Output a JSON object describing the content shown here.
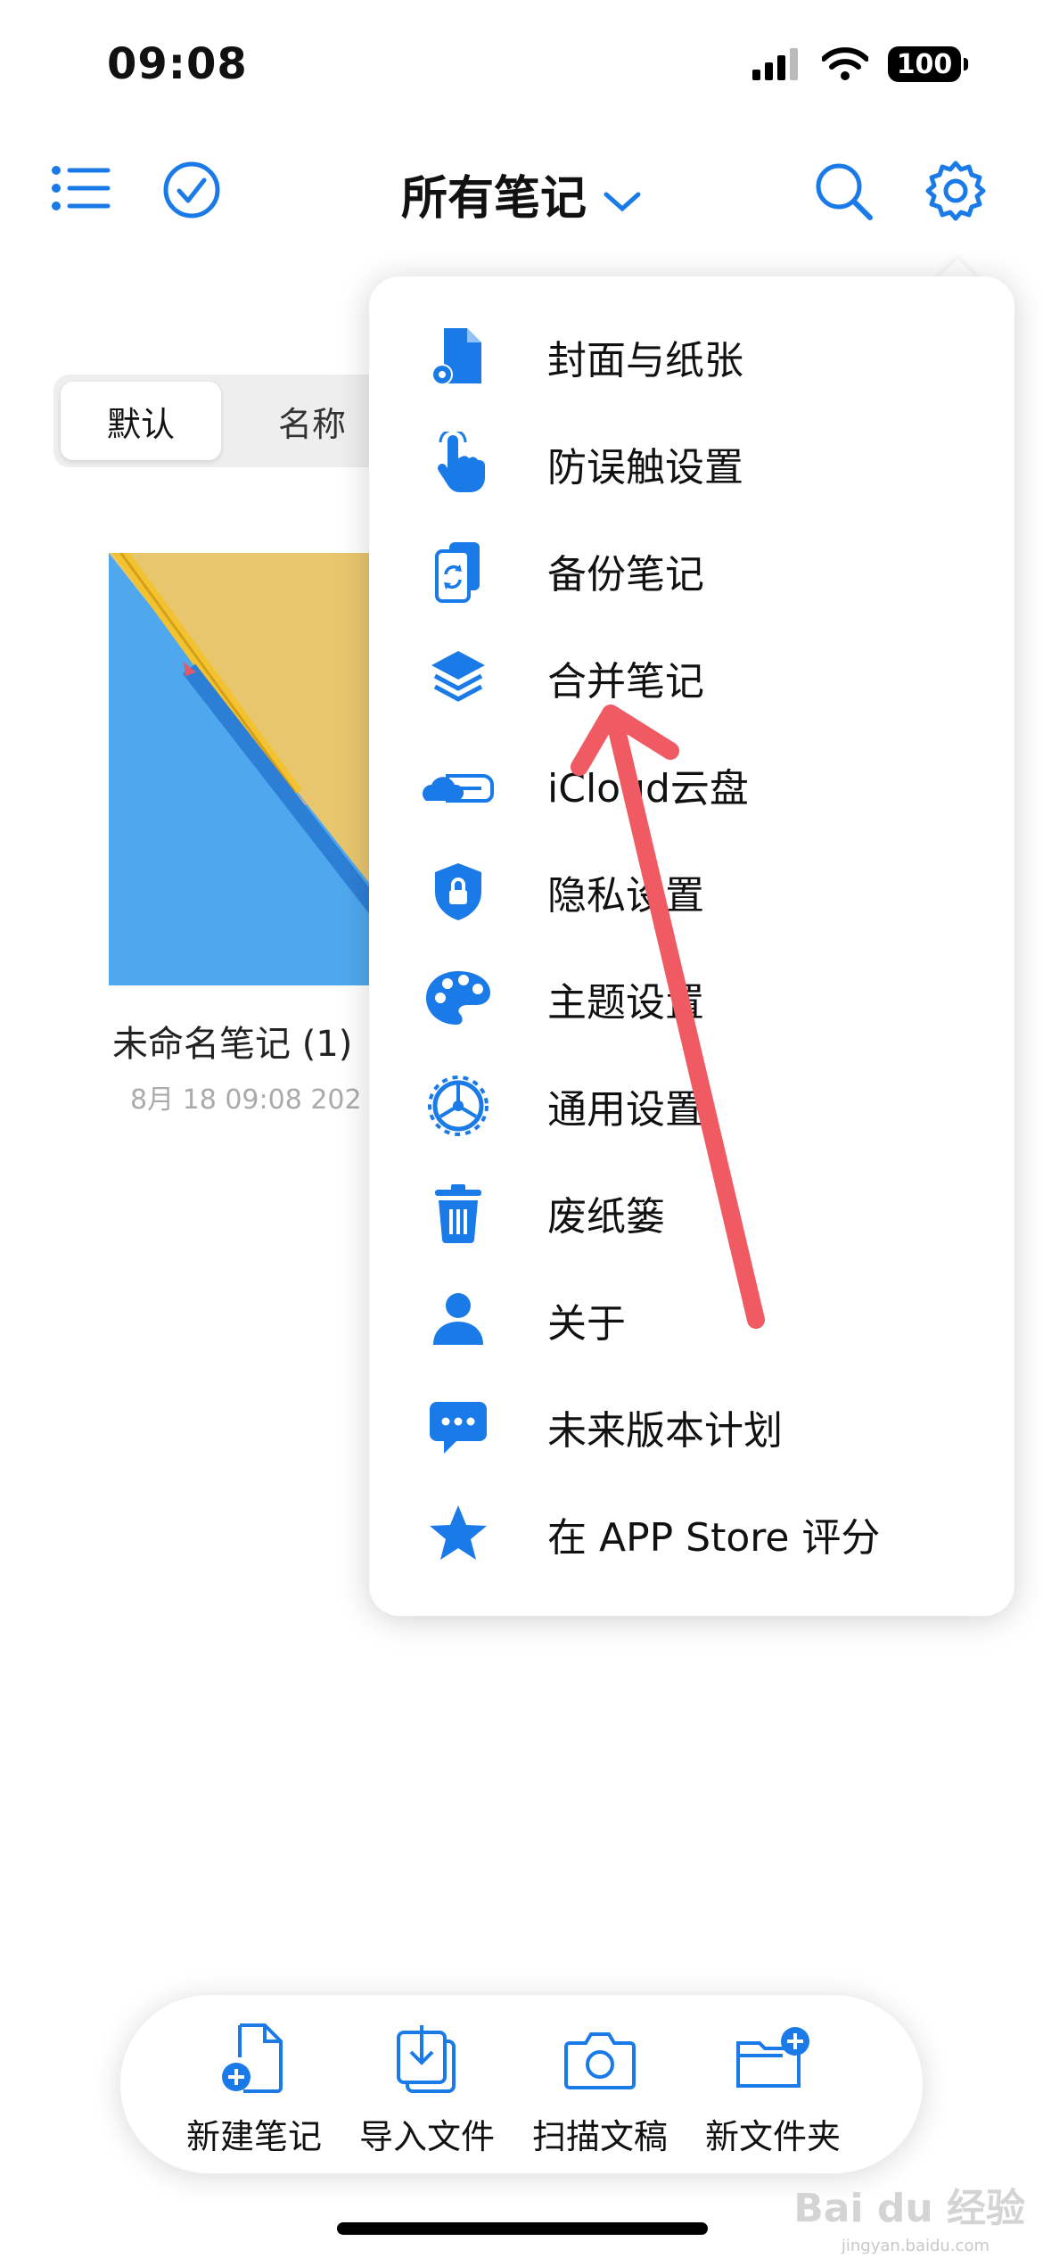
{
  "status_bar": {
    "time": "09:08",
    "battery": "100"
  },
  "nav": {
    "title": "所有笔记"
  },
  "segment": {
    "items": [
      "默认",
      "名称"
    ]
  },
  "note": {
    "title": "未命名笔记 (1)",
    "date": "8月 18 09:08 202"
  },
  "menu": {
    "items": [
      {
        "label": "封面与纸张",
        "icon": "document-gear-icon"
      },
      {
        "label": "防误触设置",
        "icon": "hand-touch-icon"
      },
      {
        "label": "备份笔记",
        "icon": "backup-sync-icon"
      },
      {
        "label": "合并笔记",
        "icon": "layers-icon"
      },
      {
        "label": "iCloud云盘",
        "icon": "icloud-drive-icon"
      },
      {
        "label": "隐私设置",
        "icon": "lock-shield-icon"
      },
      {
        "label": "主题设置",
        "icon": "palette-icon"
      },
      {
        "label": "通用设置",
        "icon": "gear-wheel-icon"
      },
      {
        "label": "废纸篓",
        "icon": "trash-icon"
      },
      {
        "label": "关于",
        "icon": "person-icon"
      },
      {
        "label": "未来版本计划",
        "icon": "chat-bubble-icon"
      },
      {
        "label": "在 APP Store 评分",
        "icon": "star-icon"
      }
    ]
  },
  "toolbar": {
    "new_note": "新建笔记",
    "import_file": "导入文件",
    "scan_doc": "扫描文稿",
    "new_folder": "新文件夹"
  },
  "watermark": {
    "text": "Bai du 经验",
    "sub": "jingyan.baidu.com"
  },
  "colors": {
    "accent": "#1a7ae8",
    "annotation_arrow": "#ef5a63"
  }
}
